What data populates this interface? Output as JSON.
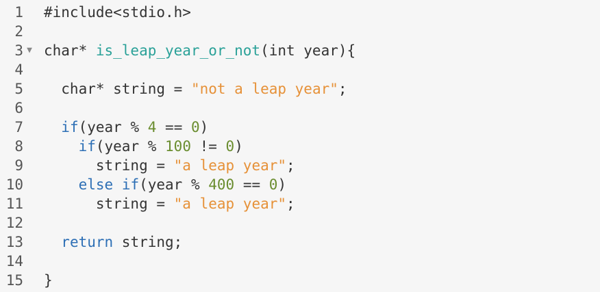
{
  "editor": {
    "fold_marker": "▼",
    "lines": [
      {
        "num": "1",
        "tokens": [
          {
            "t": "#include<stdio.h>",
            "c": "pl"
          }
        ]
      },
      {
        "num": "2",
        "tokens": []
      },
      {
        "num": "3",
        "fold": true,
        "tokens": [
          {
            "t": "char* ",
            "c": "pl"
          },
          {
            "t": "is_leap_year_or_not",
            "c": "fn"
          },
          {
            "t": "(int year){",
            "c": "pl"
          }
        ]
      },
      {
        "num": "4",
        "tokens": []
      },
      {
        "num": "5",
        "tokens": [
          {
            "t": "  char* string = ",
            "c": "pl"
          },
          {
            "t": "\"not a leap year\"",
            "c": "str"
          },
          {
            "t": ";",
            "c": "pl"
          }
        ]
      },
      {
        "num": "6",
        "tokens": []
      },
      {
        "num": "7",
        "tokens": [
          {
            "t": "  ",
            "c": "pl"
          },
          {
            "t": "if",
            "c": "kw"
          },
          {
            "t": "(year % ",
            "c": "pl"
          },
          {
            "t": "4",
            "c": "num"
          },
          {
            "t": " == ",
            "c": "pl"
          },
          {
            "t": "0",
            "c": "num"
          },
          {
            "t": ")",
            "c": "pl"
          }
        ]
      },
      {
        "num": "8",
        "tokens": [
          {
            "t": "    ",
            "c": "pl"
          },
          {
            "t": "if",
            "c": "kw"
          },
          {
            "t": "(year % ",
            "c": "pl"
          },
          {
            "t": "100",
            "c": "num"
          },
          {
            "t": " != ",
            "c": "pl"
          },
          {
            "t": "0",
            "c": "num"
          },
          {
            "t": ")",
            "c": "pl"
          }
        ]
      },
      {
        "num": "9",
        "tokens": [
          {
            "t": "      string = ",
            "c": "pl"
          },
          {
            "t": "\"a leap year\"",
            "c": "str"
          },
          {
            "t": ";",
            "c": "pl"
          }
        ]
      },
      {
        "num": "10",
        "tokens": [
          {
            "t": "    ",
            "c": "pl"
          },
          {
            "t": "else",
            "c": "kw"
          },
          {
            "t": " ",
            "c": "pl"
          },
          {
            "t": "if",
            "c": "kw"
          },
          {
            "t": "(year % ",
            "c": "pl"
          },
          {
            "t": "400",
            "c": "num"
          },
          {
            "t": " == ",
            "c": "pl"
          },
          {
            "t": "0",
            "c": "num"
          },
          {
            "t": ")",
            "c": "pl"
          }
        ]
      },
      {
        "num": "11",
        "tokens": [
          {
            "t": "      string = ",
            "c": "pl"
          },
          {
            "t": "\"a leap year\"",
            "c": "str"
          },
          {
            "t": ";",
            "c": "pl"
          }
        ]
      },
      {
        "num": "12",
        "tokens": []
      },
      {
        "num": "13",
        "tokens": [
          {
            "t": "  ",
            "c": "pl"
          },
          {
            "t": "return",
            "c": "kw"
          },
          {
            "t": " string;",
            "c": "pl"
          }
        ]
      },
      {
        "num": "14",
        "tokens": []
      },
      {
        "num": "15",
        "tokens": [
          {
            "t": "}",
            "c": "pl"
          }
        ]
      }
    ]
  },
  "colors": {
    "background": "#f6f6f6",
    "keyword": "#2d6fb5",
    "function": "#2aa198",
    "string": "#e69138",
    "number": "#6a8d2f",
    "plain": "#333333"
  }
}
